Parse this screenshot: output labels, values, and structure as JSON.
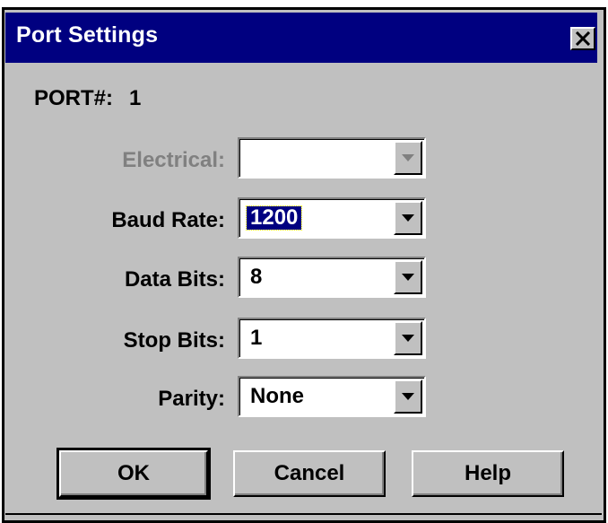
{
  "window": {
    "title": "Port Settings",
    "close_symbol": "×"
  },
  "port": {
    "label": "PORT#:",
    "value": "1"
  },
  "fields": {
    "electrical": {
      "label": "Electrical:",
      "value": "",
      "enabled": false
    },
    "baud_rate": {
      "label": "Baud Rate:",
      "value": "1200",
      "selected": true
    },
    "data_bits": {
      "label": "Data Bits:",
      "value": "8"
    },
    "stop_bits": {
      "label": "Stop Bits:",
      "value": "1"
    },
    "parity": {
      "label": "Parity:",
      "value": "None"
    }
  },
  "buttons": {
    "ok": "OK",
    "cancel": "Cancel",
    "help": "Help"
  },
  "icons": {
    "close": "close-icon",
    "dropdown": "chevron-down-icon"
  },
  "colors": {
    "titlebar": "#000080",
    "face": "#c0c0c0",
    "selection": "#000080",
    "disabled_text": "#808080"
  }
}
